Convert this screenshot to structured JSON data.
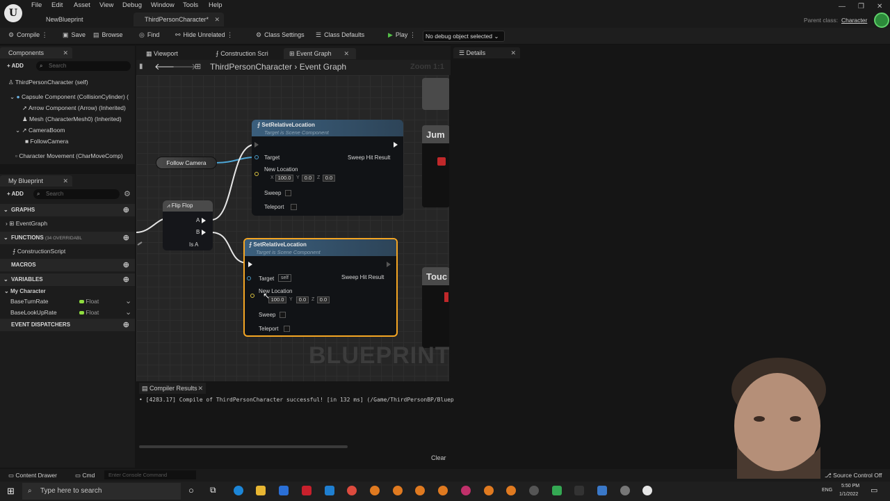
{
  "menubar": {
    "items": [
      "File",
      "Edit",
      "Asset",
      "View",
      "Debug",
      "Window",
      "Tools",
      "Help"
    ],
    "tabs": [
      "NewBlueprint",
      "ThirdPersonCharacter*"
    ],
    "parent_class_label": "Parent class:",
    "parent_class_value": "Character"
  },
  "toolbar": {
    "compile": "Compile",
    "save": "Save",
    "browse": "Browse",
    "find": "Find",
    "hide_unrelated": "Hide Unrelated",
    "class_settings": "Class Settings",
    "class_defaults": "Class Defaults",
    "play": "Play",
    "debug_object": "No debug object selected"
  },
  "components_panel": {
    "title": "Components",
    "add": "ADD",
    "search_placeholder": "Search",
    "items": [
      "ThirdPersonCharacter (self)",
      "Capsule Component (CollisionCylinder) (",
      "Arrow Component (Arrow) (Inherited)",
      "Mesh (CharacterMesh0) (Inherited)",
      "CameraBoom",
      "FollowCamera",
      "Character Movement (CharMoveComp)"
    ]
  },
  "my_blueprint": {
    "title": "My Blueprint",
    "add": "ADD",
    "search_placeholder": "Search",
    "graphs_label": "GRAPHS",
    "graph_items": [
      "EventGraph"
    ],
    "functions_label": "FUNCTIONS",
    "functions_count": "(34 OVERRIDABL",
    "function_items": [
      "ConstructionScript"
    ],
    "macros_label": "MACROS",
    "variables_label": "VARIABLES",
    "variable_category": "My Character",
    "variables": [
      {
        "name": "BaseTurnRate",
        "type": "Float"
      },
      {
        "name": "BaseLookUpRate",
        "type": "Float"
      }
    ],
    "event_dispatchers_label": "EVENT DISPATCHERS"
  },
  "editor_tabs": [
    "Viewport",
    "Construction Scri",
    "Event Graph"
  ],
  "graph": {
    "breadcrumb_root": "ThirdPersonCharacter",
    "breadcrumb_current": "Event Graph",
    "zoom": "Zoom 1:1",
    "watermark": "BLUEPRINT",
    "follow_camera": "Follow Camera",
    "flip_flop": {
      "title": "Flip Flop",
      "pin_a": "A",
      "pin_b": "B",
      "pin_is_a": "Is A"
    },
    "node1": {
      "title": "SetRelativeLocation",
      "subtitle": "Target is Scene Component",
      "target": "Target",
      "sweep_hit": "Sweep Hit Result",
      "new_location": "New Location",
      "x": "100.0",
      "y": "0.0",
      "z": "0.0",
      "sweep": "Sweep",
      "teleport": "Teleport"
    },
    "node2": {
      "title": "SetRelativeLocation",
      "subtitle": "Target is Scene Component",
      "target": "Target",
      "target_value": "self",
      "sweep_hit": "Sweep Hit Result",
      "new_location": "New Location",
      "x": "100.0",
      "y": "0.0",
      "z": "0.0",
      "sweep": "Sweep",
      "teleport": "Teleport"
    },
    "right_node_1": "Jum",
    "right_node_2": "Touc"
  },
  "details": {
    "title": "Details"
  },
  "compiler": {
    "title": "Compiler Results",
    "message": "• [4283.17] Compile of ThirdPersonCharacter successful! [in 132 ms] (/Game/ThirdPersonBP/Bluep",
    "clear": "Clear"
  },
  "statusbar": {
    "content_drawer": "Content Drawer",
    "cmd": "Cmd",
    "console_placeholder": "Enter Console Command",
    "source_control": "Source Control Off"
  },
  "taskbar": {
    "search_placeholder": "Type here to search",
    "lang": "ENG",
    "time": "5:50 PM",
    "date": "1/1/2022"
  },
  "axis_labels": {
    "x": "X",
    "y": "Y",
    "z": "Z"
  },
  "icons": {
    "play": "play-icon",
    "compile": "compile-icon",
    "save": "save-icon",
    "search": "search-icon"
  }
}
